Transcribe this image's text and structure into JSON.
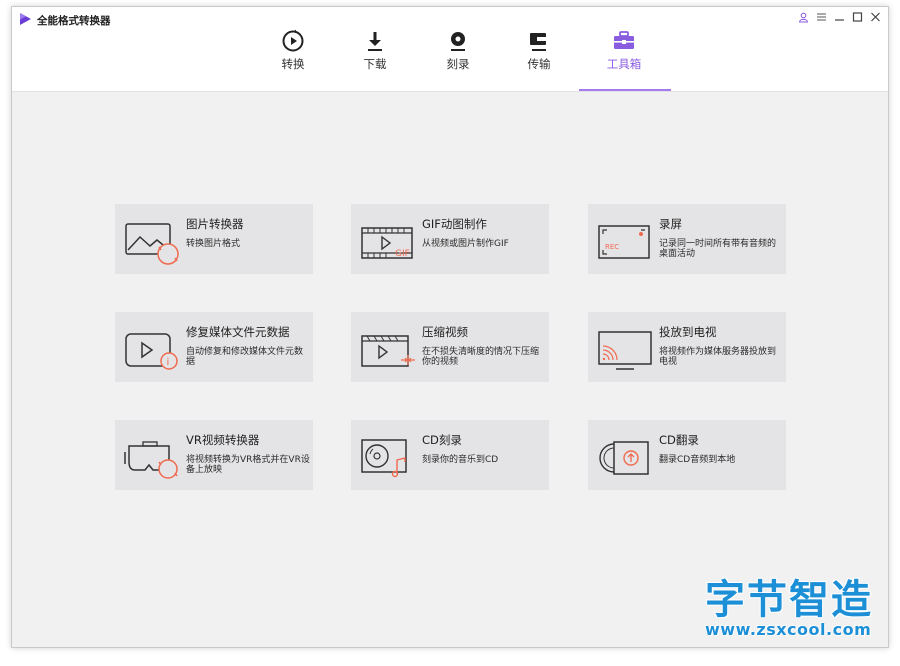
{
  "app": {
    "title": "全能格式转换器"
  },
  "colors": {
    "accent": "#a57cf0",
    "card_bg": "#e4e4e6",
    "icon_accent": "#f06a4f",
    "content_bg": "#f1f1f2"
  },
  "window_controls": [
    "user-icon",
    "menu-icon",
    "minimize-icon",
    "maximize-icon",
    "close-icon"
  ],
  "nav": {
    "tabs": [
      {
        "label": "转换",
        "icon": "convert-icon",
        "active": false
      },
      {
        "label": "下载",
        "icon": "download-icon",
        "active": false
      },
      {
        "label": "刻录",
        "icon": "burn-icon",
        "active": false
      },
      {
        "label": "传输",
        "icon": "transfer-icon",
        "active": false
      },
      {
        "label": "工具箱",
        "icon": "toolbox-icon",
        "active": true
      }
    ]
  },
  "tools": [
    {
      "title": "图片转换器",
      "desc": "转换图片格式",
      "icon": "image-convert-icon"
    },
    {
      "title": "GIF动图制作",
      "desc": "从视频或图片制作GIF",
      "icon": "gif-maker-icon"
    },
    {
      "title": "录屏",
      "desc": "记录同一时间所有带有音频的桌面活动",
      "icon": "screen-record-icon"
    },
    {
      "title": "修复媒体文件元数据",
      "desc": "自动修复和修改媒体文件元数据",
      "icon": "metadata-fix-icon"
    },
    {
      "title": "压缩视频",
      "desc": "在不损失清晰度的情况下压缩你的视频",
      "icon": "compress-video-icon"
    },
    {
      "title": "投放到电视",
      "desc": "将视频作为媒体服务器投放到电视",
      "icon": "cast-tv-icon"
    },
    {
      "title": "VR视频转换器",
      "desc": "将视频转换为VR格式并在VR设备上放映",
      "icon": "vr-convert-icon"
    },
    {
      "title": "CD刻录",
      "desc": "刻录你的音乐到CD",
      "icon": "cd-burn-icon"
    },
    {
      "title": "CD翻录",
      "desc": "翻录CD音频到本地",
      "icon": "cd-rip-icon"
    }
  ],
  "watermark": {
    "cn": "字节智造",
    "en": "www.zsxcool.com"
  }
}
